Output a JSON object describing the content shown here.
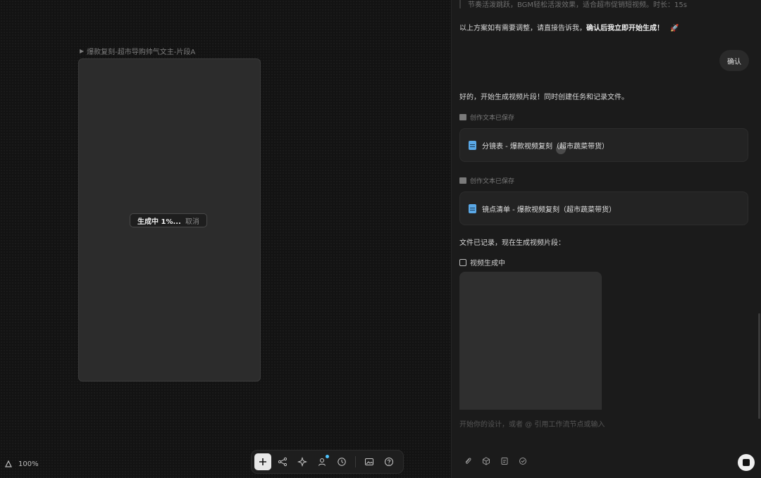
{
  "canvas": {
    "node_title": "爆款复刻-超市导购帅气文主-片段A",
    "generation_status": "生成中 1%...",
    "cancel_label": "取消",
    "zoom_level": "100%"
  },
  "toolbar": {
    "icons": [
      "plus-icon",
      "share-nodes-icon",
      "magic-icon",
      "user-icon",
      "clock-icon",
      "image-icon",
      "help-icon"
    ]
  },
  "chat": {
    "top_truncated": "节奏活泼跳跃，BGM轻松活泼效果，适合超市促销短视频。时长：15s",
    "plan_prompt_prefix": "以上方案如有需要调整，请直接告诉我，",
    "plan_prompt_bold": "确认后我立即开始生成！",
    "plan_prompt_emoji": "🚀",
    "user_confirm": "确认",
    "reply_start": "好的，开始生成视频片段！同时创建任务和记录文件。",
    "saved_label_1": "创作文本已保存",
    "doc_1": "分镜表 - 爆款视频复刻（超市蔬菜带货）",
    "saved_label_2": "创作文本已保存",
    "doc_2": "镜点清单 - 爆款视频复刻（超市蔬菜带货）",
    "recorded_text": "文件已记录，现在生成视频片段：",
    "video_generating": "视频生成中",
    "input_placeholder": "开始你的设计，或者 @ 引用工作流节点或输入"
  },
  "colors": {
    "accent_dot": "#4dc3ff",
    "doc_icon": "#5aa8e6"
  }
}
